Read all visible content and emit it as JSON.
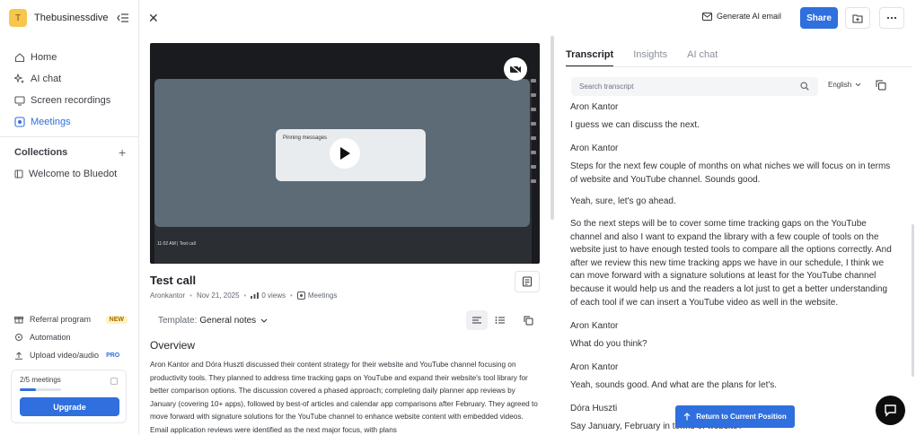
{
  "workspace": {
    "avatar_letter": "T",
    "name": "Thebusinessdive"
  },
  "nav": [
    {
      "label": "Home",
      "icon": "home-icon"
    },
    {
      "label": "AI chat",
      "icon": "sparkles-icon"
    },
    {
      "label": "Screen recordings",
      "icon": "screen-icon"
    },
    {
      "label": "Meetings",
      "icon": "meetings-icon",
      "active": true
    }
  ],
  "collections": {
    "title": "Collections",
    "items": [
      "Welcome to Bluedot"
    ]
  },
  "bottom_links": {
    "referral": "Referral program",
    "referral_badge": "NEW",
    "automation": "Automation",
    "upload": "Upload video/audio",
    "upload_badge": "PRO"
  },
  "quota": {
    "text": "2/5 meetings",
    "fraction": 0.4,
    "upgrade": "Upgrade"
  },
  "topbar": {
    "gen_email": "Generate AI email",
    "share": "Share"
  },
  "video": {
    "dialog_title": "Pinning messages",
    "time": "11:02 AM  |  Test call"
  },
  "meeting": {
    "title": "Test call",
    "author": "Aronkantor",
    "date": "Nov 21, 2025",
    "views": "0 views",
    "folder": "Meetings"
  },
  "template": {
    "label": "Template:",
    "value": "General notes"
  },
  "overview": {
    "heading": "Overview",
    "body": "Aron Kantor and Dóra Huszti discussed their content strategy for their website and YouTube channel focusing on productivity tools. They planned to address time tracking gaps on YouTube and expand their website's tool library for better comparison options. The discussion covered a phased approach; completing daily planner app reviews by January (covering 10+ apps), followed by best-of articles and calendar app comparisons after February. They agreed to move forward with signature solutions for the YouTube channel to enhance website content with embedded videos. Email application reviews were identified as the next major focus, with plans"
  },
  "tabs": [
    "Transcript",
    "Insights",
    "AI chat"
  ],
  "search": {
    "placeholder": "Search transcript"
  },
  "language": "English",
  "transcript": [
    {
      "speaker": "Aron Kantor",
      "lines": [
        "I guess we can discuss the next."
      ]
    },
    {
      "speaker": "Aron Kantor",
      "lines": [
        "Steps for the next few couple of months on what niches we will focus on in terms of website and YouTube channel. Sounds good.",
        "Yeah, sure, let's go ahead.",
        "So the next steps will be to cover some time tracking gaps on the YouTube channel and also I want to expand the library with a few couple of tools on the website just to have enough tested tools to compare all the options correctly. And after we review this new time tracking apps we have in our schedule, I think we can move forward with a signature solutions at least for the YouTube channel because it would help us and the readers a lot just to get a better understanding of each tool if we can insert a YouTube video as well in the website."
      ]
    },
    {
      "speaker": "Aron Kantor",
      "lines": [
        "What do you think?"
      ]
    },
    {
      "speaker": "Aron Kantor",
      "lines": [
        "Yeah, sounds good. And what are the plans for let's."
      ]
    },
    {
      "speaker": "Dóra Huszti",
      "lines": [
        "Say January, February in terms of website?"
      ]
    }
  ],
  "return_label": "Return to Current Position"
}
